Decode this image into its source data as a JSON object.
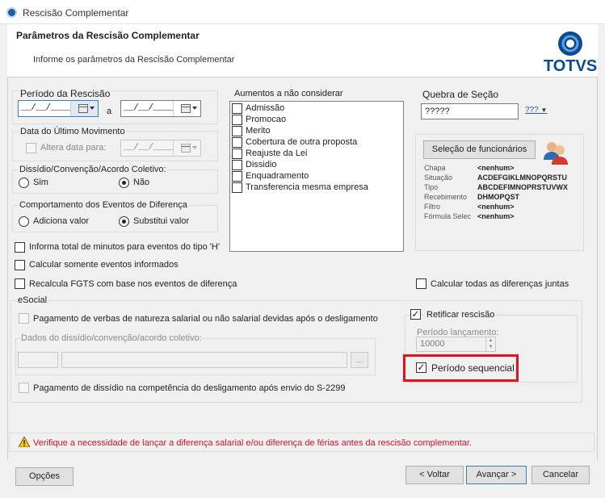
{
  "window": {
    "title": "Rescisão Complementar"
  },
  "header": {
    "title": "Parâmetros da Rescisão Complementar",
    "subtitle": "Informe os parâmetros da Rescisão Complementar",
    "logo_text": "TOTVS"
  },
  "periodo_rescisao": {
    "label": "Período da Rescisão",
    "from": "__/__/____",
    "separator": "a",
    "to": "__/__/____"
  },
  "ultimo_movimento": {
    "label": "Data do Último Movimento",
    "checkbox_label": "Altera data para:",
    "date": "__/__/____"
  },
  "dissidio": {
    "label": "Dissídio/Convenção/Acordo Coletivo:",
    "options": [
      "Sim",
      "Não"
    ],
    "selected": "Não"
  },
  "comportamento": {
    "label": "Comportamento dos Eventos de Diferença",
    "options": [
      "Adiciona valor",
      "Substitui valor"
    ],
    "selected": "Substitui valor"
  },
  "aumentos": {
    "label": "Aumentos a não considerar",
    "items": [
      "Admissão",
      "Promocao",
      "Merito",
      "Cobertura de outra proposta",
      "Reajuste da Lei",
      "Dissidio",
      "Enquadramento",
      "Transferencia mesma empresa"
    ]
  },
  "quebra_secao": {
    "label": "Quebra de Seção",
    "value": "?????",
    "btn_icon": "???"
  },
  "selecao": {
    "button": "Seleção de funcionários",
    "rows": [
      {
        "key": "Chapa",
        "value": "<nenhum>"
      },
      {
        "key": "Situação",
        "value": "ACDEFGIKLMNOPQRSTU"
      },
      {
        "key": "Tipo",
        "value": "ABCDEFIMNOPRSTUVWX"
      },
      {
        "key": "Recebimento",
        "value": "DHMOPQST"
      },
      {
        "key": "Filtro",
        "value": "<nenhum>"
      },
      {
        "key": "Fórmula Selec",
        "value": "<nenhum>"
      }
    ]
  },
  "options": {
    "informa_total": "Informa total de minutos para eventos do tipo 'H'",
    "calcular_somente": "Calcular somente eventos informados",
    "recalcula_fgts": "Recalcula FGTS com base nos eventos de diferença",
    "calcular_todas": "Calcular todas as diferenças juntas"
  },
  "esocial": {
    "label": "eSocial",
    "pagamento_verbas": "Pagamento de verbas de natureza salarial ou não salarial devidas após o desligamento",
    "dados_dissidio": "Dados do dissídio/convenção/acordo coletivo:",
    "browse_btn": "...",
    "pagamento_dissidio": "Pagamento de dissídio na competência do desligamento após envio do S-2299"
  },
  "retificar": {
    "label": "Retificar rescisão",
    "checked": true,
    "periodo_label": "Período lançamento:",
    "periodo_value": "10000",
    "sequencial_label": "Período sequencial",
    "sequencial_checked": true
  },
  "warning": {
    "text": "Verifique a necessidade de lançar a diferença salarial e/ou diferença de férias antes da rescisão complementar."
  },
  "footer": {
    "options_btn": "Opções",
    "back_btn": "< Voltar",
    "next_btn": "Avançar >",
    "cancel_btn": "Cancelar"
  },
  "colors": {
    "brand": "#0a4a8f",
    "warning_text": "#d0142b",
    "highlight": "#e3101e"
  }
}
